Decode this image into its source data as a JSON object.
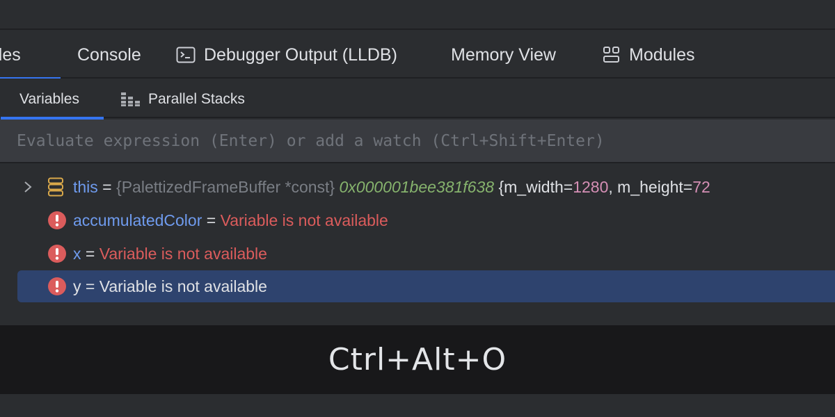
{
  "main_tabs": [
    {
      "label": "Variables",
      "visible_label": "ables",
      "active": true
    },
    {
      "label": "Console",
      "visible_label": "Console",
      "active": false
    },
    {
      "label": "Debugger Output (LLDB)",
      "icon": "terminal-icon",
      "active": false
    },
    {
      "label": "Memory View",
      "active": false
    },
    {
      "label": "Modules",
      "icon": "modules-icon",
      "active": false
    }
  ],
  "sub_tabs": [
    {
      "label": "Variables",
      "active": true
    },
    {
      "label": "Parallel Stacks",
      "icon": "parallel-stacks-icon",
      "active": false
    }
  ],
  "evaluate": {
    "value": "",
    "placeholder": "Evaluate expression (Enter) or add a watch (Ctrl+Shift+Enter)"
  },
  "variables": [
    {
      "name": "this",
      "eq": " = ",
      "type": "{PalettizedFrameBuffer *const} ",
      "address": "0x000001bee381f638",
      "fields_prefix": " {m_width=",
      "m_width": "1280",
      "fields_mid": ", m_height=",
      "m_height_partial": "72",
      "icon": "object-fields-icon",
      "expandable": true,
      "selected": false
    },
    {
      "name": "accumulatedColor",
      "eq": " = ",
      "value": "Variable is not available",
      "icon": "error-icon",
      "selected": false
    },
    {
      "name": "x",
      "eq": " = ",
      "value": "Variable is not available",
      "icon": "error-icon",
      "selected": false
    },
    {
      "name": "y",
      "eq": " = ",
      "value": "Variable is not available",
      "icon": "error-icon",
      "selected": true
    }
  ],
  "shortcut": {
    "text": "Ctrl+Alt+O"
  },
  "colors": {
    "accent": "#3574f0",
    "selection": "#2e436e",
    "error": "#db5c5c",
    "name": "#6f9bee",
    "address": "#86b36d",
    "number": "#d58fb5",
    "icon_object": "#d9a84a"
  }
}
